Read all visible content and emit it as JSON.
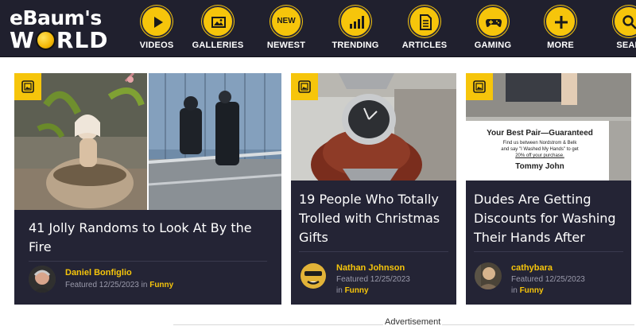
{
  "logo": {
    "line1": "eBaum's",
    "line2a": "W",
    "line2b": "RLD"
  },
  "nav": [
    {
      "label": "VIDEOS",
      "icon": "play-icon"
    },
    {
      "label": "GALLERIES",
      "icon": "image-icon"
    },
    {
      "label": "NEWEST",
      "icon": "new-badge-icon",
      "icon_text": "NEW"
    },
    {
      "label": "TRENDING",
      "icon": "bar-chart-icon"
    },
    {
      "label": "ARTICLES",
      "icon": "document-icon"
    },
    {
      "label": "GAMING",
      "icon": "gamepad-icon"
    },
    {
      "label": "MORE",
      "icon": "plus-icon"
    },
    {
      "label": "SEAR",
      "icon": "search-icon"
    }
  ],
  "cards": [
    {
      "title": "41 Jolly Randoms to Look At By the Fire",
      "author": "Daniel Bonfiglio",
      "featured": "Featured 12/25/2023",
      "in": "in",
      "category": "Funny",
      "badge_icon": "gallery-icon"
    },
    {
      "title": "19 People Who Totally Trolled with Christmas Gifts",
      "author": "Nathan Johnson",
      "featured": "Featured 12/25/2023",
      "in": "in",
      "category": "Funny",
      "badge_icon": "gallery-icon"
    },
    {
      "title": "Dudes Are Getting Discounts for Washing Their Hands After",
      "author": "cathybara",
      "featured": "Featured 12/25/2023",
      "in": "in",
      "category": "Funny",
      "badge_icon": "gallery-icon",
      "sign": {
        "headline": "Your Best Pair—Guaranteed",
        "line1": "Find us between Nordstrom & Belk",
        "line2": "and say \"I Washed My Hands\" to get",
        "line3": "20% off your purchase.",
        "brand": "Tommy John"
      }
    }
  ],
  "ad": {
    "label": "Advertisement"
  },
  "colors": {
    "header_bg": "#20202e",
    "accent": "#f6c50b",
    "card_bg": "#242435"
  }
}
